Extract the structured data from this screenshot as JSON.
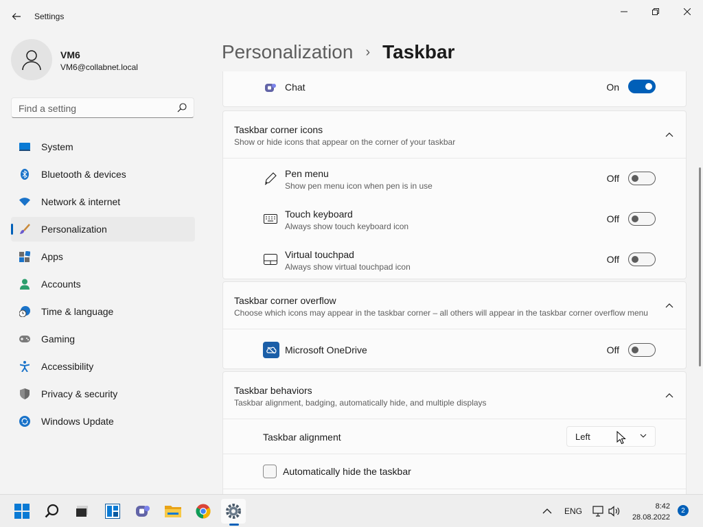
{
  "window": {
    "title": "Settings"
  },
  "user": {
    "name": "VM6",
    "email": "VM6@collabnet.local"
  },
  "search": {
    "placeholder": "Find a setting"
  },
  "sidebar": {
    "items": [
      {
        "label": "System",
        "icon": "system-icon"
      },
      {
        "label": "Bluetooth & devices",
        "icon": "bluetooth-icon"
      },
      {
        "label": "Network & internet",
        "icon": "wifi-icon"
      },
      {
        "label": "Personalization",
        "icon": "brush-icon",
        "active": true
      },
      {
        "label": "Apps",
        "icon": "apps-icon"
      },
      {
        "label": "Accounts",
        "icon": "person-icon"
      },
      {
        "label": "Time & language",
        "icon": "globe-clock-icon"
      },
      {
        "label": "Gaming",
        "icon": "gamepad-icon"
      },
      {
        "label": "Accessibility",
        "icon": "accessibility-icon"
      },
      {
        "label": "Privacy & security",
        "icon": "shield-icon"
      },
      {
        "label": "Windows Update",
        "icon": "update-icon"
      }
    ]
  },
  "breadcrumb": {
    "parent": "Personalization",
    "separator": "›",
    "current": "Taskbar"
  },
  "content": {
    "chat": {
      "label": "Chat",
      "state": "On",
      "enabled": true
    },
    "corner_icons": {
      "title": "Taskbar corner icons",
      "subtitle": "Show or hide icons that appear on the corner of your taskbar",
      "items": [
        {
          "title": "Pen menu",
          "subtitle": "Show pen menu icon when pen is in use",
          "state": "Off",
          "icon": "pen-icon"
        },
        {
          "title": "Touch keyboard",
          "subtitle": "Always show touch keyboard icon",
          "state": "Off",
          "icon": "keyboard-icon"
        },
        {
          "title": "Virtual touchpad",
          "subtitle": "Always show virtual touchpad icon",
          "state": "Off",
          "icon": "touchpad-icon"
        }
      ]
    },
    "corner_overflow": {
      "title": "Taskbar corner overflow",
      "subtitle": "Choose which icons may appear in the taskbar corner – all others will appear in the taskbar corner overflow menu",
      "items": [
        {
          "title": "Microsoft OneDrive",
          "state": "Off",
          "icon": "onedrive-icon"
        }
      ]
    },
    "behaviors": {
      "title": "Taskbar behaviors",
      "subtitle": "Taskbar alignment, badging, automatically hide, and multiple displays",
      "alignment_label": "Taskbar alignment",
      "alignment_value": "Left",
      "autohide_label": "Automatically hide the taskbar",
      "autohide_checked": false
    }
  },
  "taskbar": {
    "apps": [
      "start-icon",
      "search-icon",
      "task-view-icon",
      "widgets-icon",
      "teams-chat-icon",
      "file-explorer-icon",
      "chrome-icon",
      "settings-icon"
    ],
    "language": "ENG",
    "time": "8:42",
    "date": "28.08.2022",
    "notifications": "2"
  },
  "colors": {
    "accent": "#005fb8",
    "background": "#f3f3f3",
    "card": "#fbfbfb"
  }
}
